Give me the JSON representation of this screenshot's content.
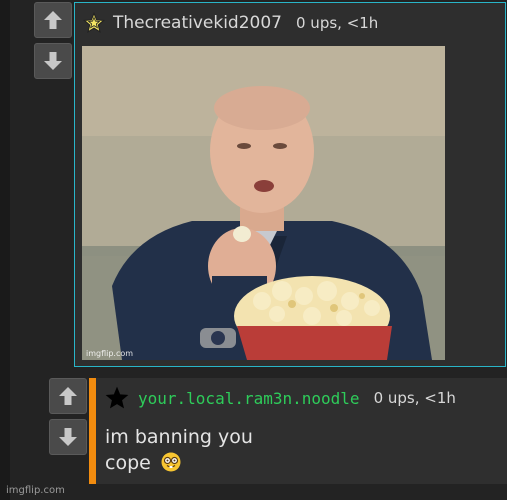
{
  "comment1": {
    "username": "Thecreativekid2007",
    "meta": "0 ups, <1h",
    "badge_icon": "star-outline-icon",
    "image_watermark": "imgflip.com",
    "image_description_icon": "photo"
  },
  "comment2": {
    "username": "your.local.ram3n.noodle",
    "meta": "0 ups, <1h",
    "badge_icon": "star-filled-icon",
    "line1": "im banning you",
    "line2": "cope"
  },
  "footer": {
    "watermark": "imgflip.com"
  },
  "colors": {
    "accent_border": "#29b5c8",
    "reply_bar": "#f28c0f",
    "username_green": "#2ecc5a"
  }
}
